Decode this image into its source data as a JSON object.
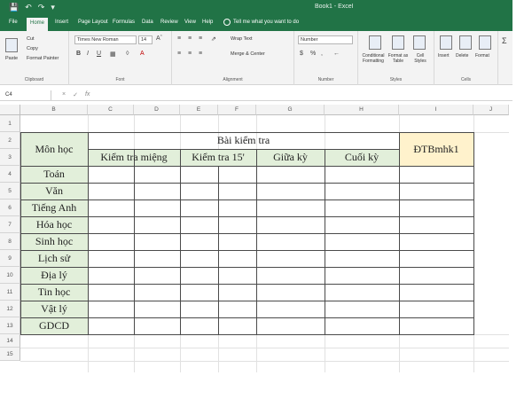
{
  "window": {
    "title": "Book1 - Excel",
    "qat": [
      "💾",
      "↶",
      "↷",
      "▾"
    ]
  },
  "tabs": [
    "File",
    "Home",
    "Insert",
    "Page Layout",
    "Formulas",
    "Data",
    "Review",
    "View",
    "Help"
  ],
  "tell_me": "Tell me what you want to do",
  "ribbon": {
    "clipboard": {
      "paste": "Paste",
      "cut": "Cut",
      "copy": "Copy",
      "format_painter": "Format Painter",
      "label": "Clipboard"
    },
    "font": {
      "name": "Times New Roman",
      "size": "14",
      "label": "Font",
      "bold": "B",
      "italic": "I",
      "underline": "U"
    },
    "alignment": {
      "wrap_text": "Wrap Text",
      "merge_center": "Merge & Center",
      "label": "Alignment"
    },
    "number": {
      "format": "Number",
      "currency": "$",
      "percent": "%",
      "comma": ",",
      "label": "Number"
    },
    "styles": {
      "conditional": "Conditional Formatting",
      "format_table": "Format as Table",
      "cell_styles": "Cell Styles",
      "label": "Styles"
    },
    "cells": {
      "insert": "Insert",
      "delete": "Delete",
      "format": "Format",
      "label": "Cells"
    },
    "editing": {
      "sum": "Σ"
    }
  },
  "formula_bar": {
    "name_box": "C4",
    "cancel": "×",
    "enter": "✓",
    "fx": "fx",
    "value": ""
  },
  "columns": [
    "B",
    "C",
    "D",
    "E",
    "F",
    "G",
    "H",
    "I",
    "J"
  ],
  "rows": [
    "1",
    "2",
    "3",
    "4",
    "5",
    "6",
    "7",
    "8",
    "9",
    "10",
    "11",
    "12",
    "13",
    "14",
    "15"
  ],
  "sheet": {
    "mon_hoc": "Môn học",
    "bai_kiem_tra": "Bài kiểm tra",
    "dtb": "ĐTBmhk1",
    "sub_headers": [
      "Kiểm tra miệng",
      "Kiểm tra 15'",
      "Giữa kỳ",
      "Cuối kỳ"
    ],
    "subjects": [
      "Toán",
      "Văn",
      "Tiếng Anh",
      "Hóa học",
      "Sinh học",
      "Lịch sử",
      "Địa lý",
      "Tin học",
      "Vật lý",
      "GDCD"
    ]
  }
}
